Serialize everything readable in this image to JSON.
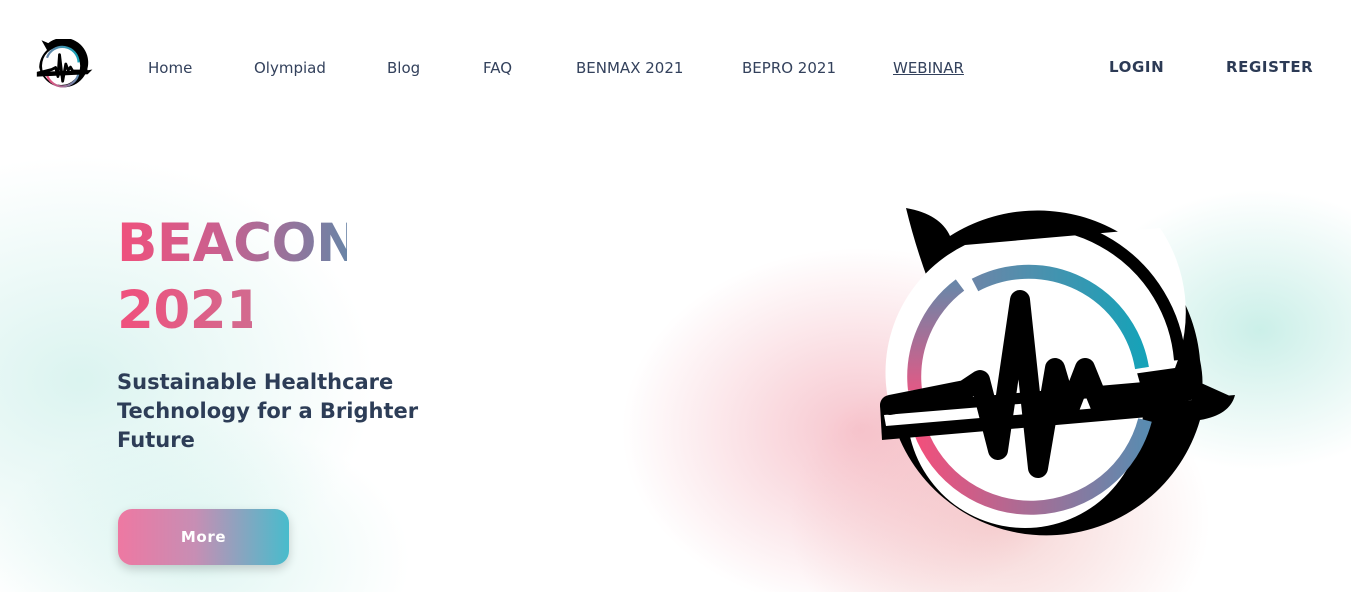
{
  "nav": {
    "items": [
      {
        "label": "Home"
      },
      {
        "label": "Olympiad"
      },
      {
        "label": "Blog"
      },
      {
        "label": "FAQ"
      },
      {
        "label": "BENMAX 2021"
      },
      {
        "label": "BEPRO 2021"
      },
      {
        "label": "WEBINAR",
        "active": true
      }
    ],
    "login_label": "LOGIN",
    "register_label": "REGISTER"
  },
  "hero": {
    "title_line1": "BEACON",
    "title_line2": "2021",
    "subtitle": "Sustainable Healthcare Technology for a Brighter Future",
    "more_label": "More"
  },
  "colors": {
    "pink": "#f0507c",
    "teal": "#17a2b8",
    "slate": "#6a84a6",
    "text_dark": "#2d3d57"
  },
  "icons": {
    "logo": "heartbeat-speech-bubble-logo"
  }
}
